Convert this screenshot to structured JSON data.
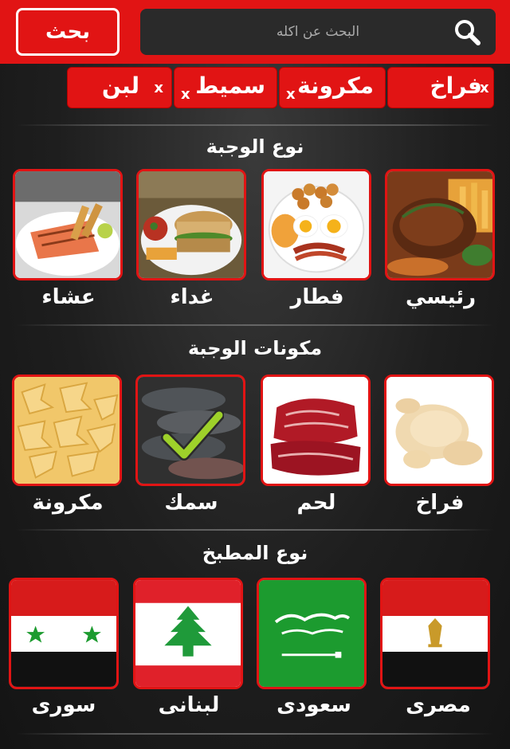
{
  "header": {
    "search_button_label": "بحث",
    "search_placeholder": "البحث عن اكله"
  },
  "selected_chips": [
    {
      "label": "فراخ",
      "remove": "x"
    },
    {
      "label": "مكرونة",
      "remove": "x"
    },
    {
      "label": "سميط",
      "remove": "x"
    },
    {
      "label": "لبن",
      "remove": "x"
    }
  ],
  "sections": {
    "meal_type": {
      "title": "نوع الوجبة",
      "items": [
        {
          "label": "رئيسي",
          "icon": "steak-image"
        },
        {
          "label": "فطار",
          "icon": "breakfast-image"
        },
        {
          "label": "غداء",
          "icon": "lunch-sandwich-image"
        },
        {
          "label": "عشاء",
          "icon": "dinner-salmon-image"
        }
      ]
    },
    "ingredients": {
      "title": "مكونات الوجبة",
      "items": [
        {
          "label": "فراخ",
          "icon": "chicken-image",
          "selected": false
        },
        {
          "label": "لحم",
          "icon": "meat-image",
          "selected": false
        },
        {
          "label": "سمك",
          "icon": "fish-image",
          "selected": true
        },
        {
          "label": "مكرونة",
          "icon": "pasta-image",
          "selected": false
        }
      ]
    },
    "cuisine": {
      "title": "نوع المطبخ",
      "items": [
        {
          "label": "مصرى",
          "icon": "egypt-flag"
        },
        {
          "label": "سعودى",
          "icon": "saudi-flag"
        },
        {
          "label": "لبنانى",
          "icon": "lebanon-flag"
        },
        {
          "label": "سورى",
          "icon": "syria-flag"
        }
      ]
    }
  },
  "colors": {
    "accent": "#e11414",
    "background": "#1e1e1e"
  }
}
